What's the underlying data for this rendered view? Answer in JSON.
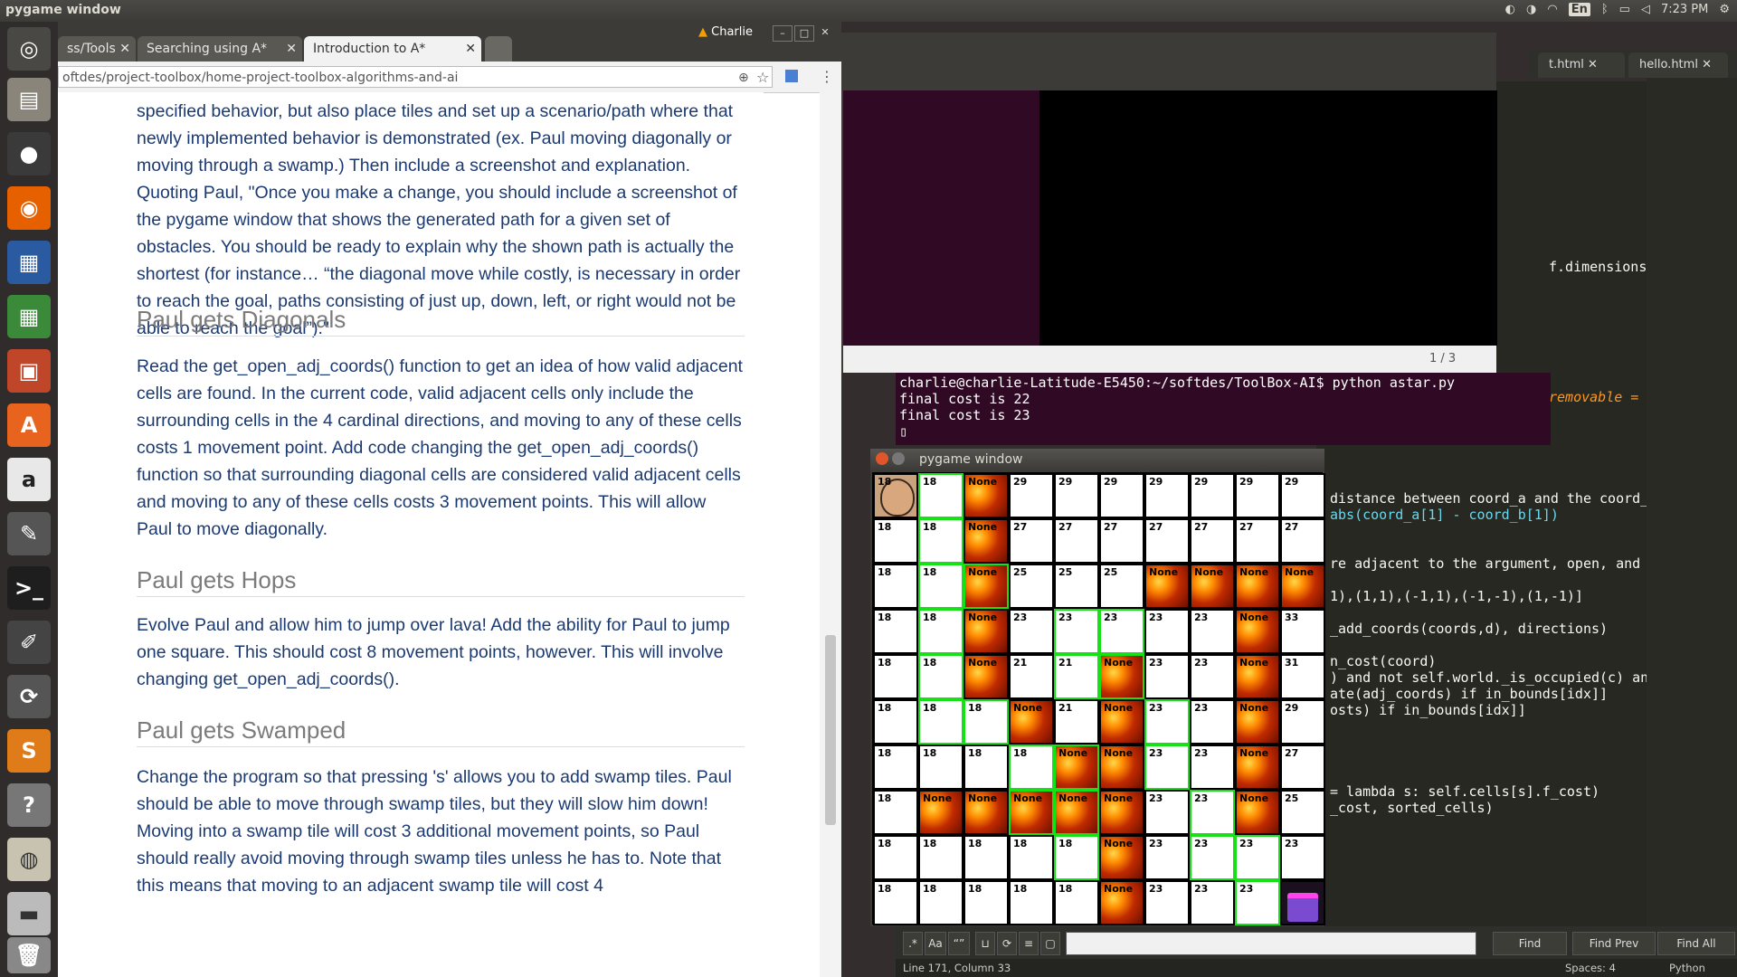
{
  "topbar": {
    "title": "pygame window",
    "kb": "En",
    "time": "7:23 PM"
  },
  "browser": {
    "tabs": [
      {
        "label": "ss/Tools"
      },
      {
        "label": "Searching using A*"
      },
      {
        "label": "Introduction to A*"
      }
    ],
    "profile": "Charlie",
    "url": "oftdes/project-toolbox/home-project-toolbox-algorithms-and-ai",
    "paragraphs": [
      "specified behavior, but also place tiles and set up a scenario/path where that newly implemented behavior is demonstrated (ex. Paul moving diagonally or moving through a swamp.) Then include a screenshot and explanation. Quoting Paul, \"Once you make a change, you should include a screenshot of the pygame window that shows the generated path for a given set of obstacles. You should be ready to explain why the shown path is actually the shortest (for instance… “the diagonal move while costly, is necessary in order to reach the goal, paths consisting of just up, down, left, or right would not be able to reach the goal”).\"",
      "Read the get_open_adj_coords() function to get an idea of how valid adjacent cells are found. In the current code, valid adjacent cells only include the surrounding cells in the 4 cardinal directions, and moving to any of these cells costs 1 movement point. Add code changing the get_open_adj_coords() function so that surrounding diagonal cells are considered valid adjacent cells and moving to any of these cells costs 3 movement points. This will allow Paul to move diagonally.",
      "Evolve Paul and allow him to jump over lava! Add the ability for Paul to jump one square. This should cost 8 movement points, however. This will involve changing get_open_adj_coords().",
      "Change the program so that pressing 's' allows you to add swamp tiles. Paul should be able to move through swamp tiles, but they will slow him down! Moving into a swamp tile will cost 3 additional movement points, so Paul should really avoid moving through swamp tiles unless he has to. Note that this means that moving to an adjacent swamp tile will cost 4"
    ],
    "headings": [
      "Paul gets Diagonals",
      "Paul gets Hops",
      "Paul gets Swamped"
    ]
  },
  "terminal": {
    "lines": [
      "charlie@charlie-Latitude-E5450:~/softdes/ToolBox-AI$ python astar.py",
      "final cost is 22",
      "final cost is 23"
    ]
  },
  "overview": {
    "counter": "1 / 3"
  },
  "editor": {
    "tabs": [
      "t.html",
      "hello.html"
    ],
    "code_lines": [
      {
        "text": "f.dimensions"
      },
      {
        "text": "removable ="
      },
      {
        "text": "distance between coord_a and the coord_"
      },
      {
        "text": "abs(coord_a[1] - coord_b[1])"
      },
      {
        "text": "re adjacent to the argument, open, and"
      },
      {
        "text": "1),(1,1),(-1,1),(-1,-1),(1,-1)]"
      },
      {
        "text": "_add_coords(coords,d), directions)"
      },
      {
        "text": "n_cost(coord)"
      },
      {
        "text": ") and not self.world._is_occupied(c) and"
      },
      {
        "text": "ate(adj_coords) if in_bounds[idx]]"
      },
      {
        "text": "osts) if in_bounds[idx]]"
      },
      {
        "text": "= lambda s: self.cells[s].f_cost)"
      },
      {
        "text": "_cost, sorted_cells)"
      }
    ],
    "find_buttons": [
      "Find",
      "Find Prev",
      "Find All"
    ],
    "find_glyphs": [
      ".*",
      "Aa",
      "“”"
    ],
    "status_left": "Line 171, Column 33",
    "status_spaces": "Spaces: 4",
    "status_lang": "Python"
  },
  "pygame": {
    "title": "pygame window",
    "grid": [
      [
        "18",
        "18",
        "None",
        "29",
        "29",
        "29",
        "29",
        "29",
        "29",
        "29"
      ],
      [
        "18",
        "18",
        "None",
        "27",
        "27",
        "27",
        "27",
        "27",
        "27",
        "27"
      ],
      [
        "18",
        "18",
        "None",
        "25",
        "25",
        "25",
        "None",
        "None",
        "None",
        "None"
      ],
      [
        "18",
        "18",
        "None",
        "23",
        "23",
        "23",
        "23",
        "23",
        "None",
        "33"
      ],
      [
        "18",
        "18",
        "None",
        "21",
        "21",
        "None",
        "23",
        "23",
        "None",
        "31"
      ],
      [
        "18",
        "18",
        "18",
        "None",
        "21",
        "None",
        "23",
        "23",
        "None",
        "29"
      ],
      [
        "18",
        "18",
        "18",
        "18",
        "None",
        "None",
        "23",
        "23",
        "None",
        "27"
      ],
      [
        "18",
        "None",
        "None",
        "None",
        "None",
        "None",
        "23",
        "23",
        "None",
        "25"
      ],
      [
        "18",
        "18",
        "18",
        "18",
        "18",
        "None",
        "23",
        "23",
        "23",
        "23"
      ],
      [
        "18",
        "18",
        "18",
        "18",
        "18",
        "None",
        "23",
        "23",
        "23",
        ""
      ]
    ],
    "start": "18"
  }
}
